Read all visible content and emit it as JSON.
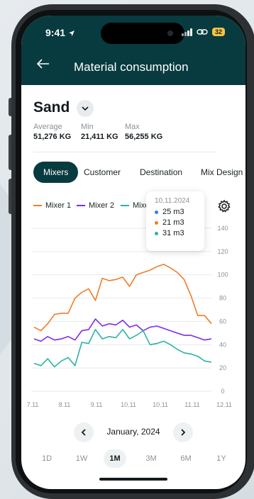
{
  "status": {
    "time": "9:41",
    "battery": "32"
  },
  "header": {
    "title": "Material consumption"
  },
  "material": {
    "name": "Sand"
  },
  "stats": [
    {
      "label": "Average",
      "value": "51,276 KG"
    },
    {
      "label": "Min",
      "value": "21,411 KG"
    },
    {
      "label": "Max",
      "value": "56,255 KG"
    }
  ],
  "tabs": [
    "Mixers",
    "Customer",
    "Destination",
    "Mix Design"
  ],
  "legend": [
    {
      "name": "Mixer 1",
      "color": "#f07c2a"
    },
    {
      "name": "Mixer 2",
      "color": "#7b2cf0"
    },
    {
      "name": "Mixe",
      "color": "#2bb3a3"
    }
  ],
  "tooltip": {
    "date": "10.11.2024",
    "rows": [
      {
        "value": "25 m3",
        "color": "#3d7be0"
      },
      {
        "value": "21 m3",
        "color": "#f07c2a"
      },
      {
        "value": "31 m3",
        "color": "#2bb3a3"
      }
    ]
  },
  "chart_data": {
    "type": "line",
    "x_ticks": [
      "7.11",
      "8.11",
      "9.11",
      "10.11",
      "10.11",
      "11.11",
      "12.11"
    ],
    "y_ticks": [
      0,
      20,
      40,
      60,
      80,
      100,
      120,
      140
    ],
    "ylim": [
      0,
      140
    ],
    "series": [
      {
        "name": "Mixer 1",
        "color": "#f07c2a",
        "values": [
          55,
          52,
          58,
          66,
          67,
          67,
          80,
          85,
          88,
          78,
          97,
          95,
          96,
          98,
          90,
          100,
          102,
          104,
          107,
          109,
          106,
          102,
          96,
          82,
          65,
          65,
          58
        ]
      },
      {
        "name": "Mixer 2",
        "color": "#7b2cf0",
        "values": [
          45,
          43,
          47,
          44,
          45,
          47,
          44,
          52,
          53,
          62,
          56,
          58,
          57,
          61,
          55,
          57,
          52,
          55,
          56,
          54,
          52,
          50,
          48,
          48,
          46,
          44,
          45
        ]
      },
      {
        "name": "Mixe",
        "color": "#2bb3a3",
        "values": [
          24,
          22,
          28,
          21,
          26,
          29,
          22,
          42,
          41,
          53,
          45,
          47,
          46,
          53,
          45,
          48,
          52,
          40,
          41,
          43,
          40,
          36,
          33,
          32,
          30,
          26,
          25
        ]
      }
    ]
  },
  "month_nav": {
    "label": "January, 2024"
  },
  "ranges": [
    "1D",
    "1W",
    "1M",
    "3M",
    "6M",
    "1Y"
  ]
}
